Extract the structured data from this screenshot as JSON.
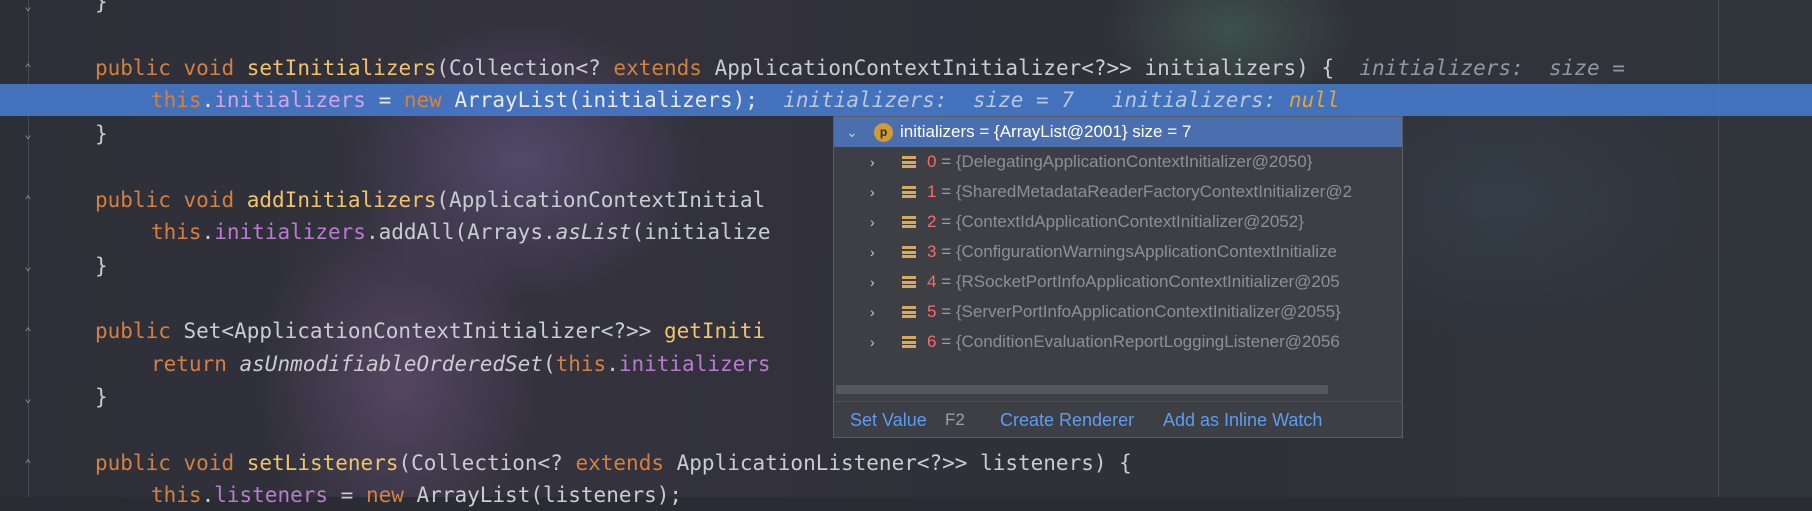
{
  "code": {
    "line1": {
      "kw_public": "public",
      "kw_void": "void",
      "method": "setInitializers",
      "open": "(Collection<? ",
      "kw_extends": "extends",
      "type": " ApplicationContextInitializer<?>> initializers) {",
      "hint": "  initializers:  size = "
    },
    "line2": {
      "kw_this": "this",
      "dot": ".",
      "field": "initializers",
      "assign": " = ",
      "kw_new": "new",
      "rest": " ArrayList(initializers);",
      "hint1": "  initializers:  size = 7   initializers: ",
      "hint_null": "null"
    },
    "line3": {
      "text": "}"
    },
    "line4": {
      "kw_public": "public",
      "kw_void": "void",
      "method": "addInitializers",
      "rest": "(ApplicationContextInitial"
    },
    "line5": {
      "kw_this": "this",
      "dot": ".",
      "field": "initializers",
      "call": ".addAll(Arrays.",
      "it": "asList",
      "rest": "(initialize"
    },
    "line6": {
      "text": "}"
    },
    "line7": {
      "kw_public": "public",
      "type": " Set<ApplicationContextInitializer<?>> ",
      "method": "getIniti"
    },
    "line8": {
      "kw_return": "return",
      "it": "asUnmodifiableOrderedSet",
      "open": "(",
      "kw_this": "this",
      "dot": ".",
      "field": "initializers"
    },
    "line9": {
      "text": "}"
    },
    "line10": {
      "kw_public": "public",
      "kw_void": "void",
      "method": "setListeners",
      "open": "(Collection<? ",
      "kw_extends": "extends",
      "type": " ApplicationListener<?>> listeners) {"
    },
    "line11": {
      "kw_this": "this",
      "dot": ".",
      "field": "listeners",
      "assign": " = ",
      "kw_new": "new",
      "rest": " ArrayList(listeners);"
    }
  },
  "popup": {
    "header": {
      "badge": "p",
      "name": "initializers",
      "eq": " = ",
      "value": "{ArrayList@2001}",
      "size": "  size = 7"
    },
    "items": [
      {
        "index": "0",
        "eq": " = ",
        "value": "{DelegatingApplicationContextInitializer@2050}"
      },
      {
        "index": "1",
        "eq": " = ",
        "value": "{SharedMetadataReaderFactoryContextInitializer@2"
      },
      {
        "index": "2",
        "eq": " = ",
        "value": "{ContextIdApplicationContextInitializer@2052}"
      },
      {
        "index": "3",
        "eq": " = ",
        "value": "{ConfigurationWarningsApplicationContextInitialize"
      },
      {
        "index": "4",
        "eq": " = ",
        "value": "{RSocketPortInfoApplicationContextInitializer@205"
      },
      {
        "index": "5",
        "eq": " = ",
        "value": "{ServerPortInfoApplicationContextInitializer@2055}"
      },
      {
        "index": "6",
        "eq": " = ",
        "value": "{ConditionEvaluationReportLoggingListener@2056"
      }
    ],
    "footer": {
      "set_value": "Set Value",
      "set_value_key": "F2",
      "create_renderer": "Create Renderer",
      "add_inline_watch": "Add as Inline Watch"
    }
  },
  "colors": {
    "highlight": "#4577c8",
    "keyword": "#d4803f",
    "method": "#f2c46a",
    "field": "#b87ccf",
    "link": "#5d9cf3"
  }
}
